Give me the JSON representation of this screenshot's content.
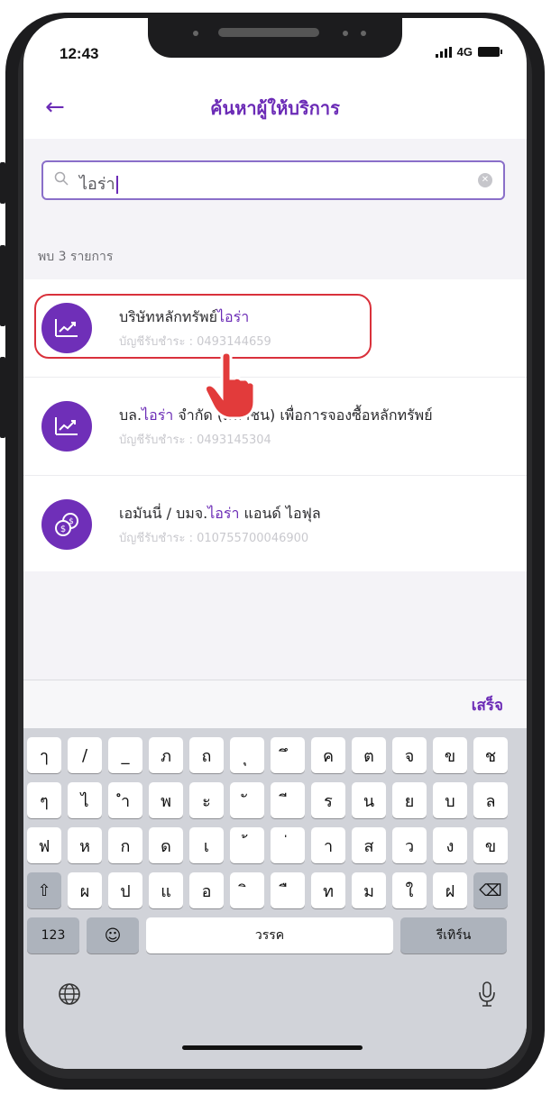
{
  "status_bar": {
    "time": "12:43",
    "network": "4G"
  },
  "header": {
    "back_icon": "arrow-left-icon",
    "title": "ค้นหาผู้ให้บริการ"
  },
  "search": {
    "value": "ไอร่า",
    "icon": "search-icon",
    "clear_icon": "clear-icon"
  },
  "results_count": "พบ 3 รายการ",
  "results": [
    {
      "name_prefix": "บริษัทหลักทรัพย์",
      "name_highlight": "ไอร่า",
      "name_suffix": "",
      "account": "บัญชีรับชำระ : 0493144659",
      "icon": "chart-up-icon"
    },
    {
      "name_prefix": "บล.",
      "name_highlight": "ไอร่า",
      "name_suffix": " จำกัด (มหาชน) เพื่อการจองซื้อหลักทรัพย์",
      "account": "บัญชีรับชำระ : 0493145304",
      "icon": "chart-up-icon"
    },
    {
      "name_prefix": "เอมันนี่ / บมจ.",
      "name_highlight": "ไอร่า",
      "name_suffix": " แอนด์ ไอฟุล",
      "account": "บัญชีรับชำระ : 010755700046900",
      "icon": "coins-icon"
    }
  ],
  "keyboard": {
    "done_label": "เสร็จ",
    "row1": [
      "ๅ",
      "/",
      "_",
      "ภ",
      "ถ",
      "ุ",
      "ึ",
      "ค",
      "ต",
      "จ",
      "ข",
      "ช"
    ],
    "row2": [
      "ๆ",
      "ไ",
      "ำ",
      "พ",
      "ะ",
      "ั",
      "ี",
      "ร",
      "น",
      "ย",
      "บ",
      "ล"
    ],
    "row3": [
      "ฟ",
      "ห",
      "ก",
      "ด",
      "เ",
      "้",
      "่",
      "า",
      "ส",
      "ว",
      "ง",
      "ข"
    ],
    "row4": [
      "ผ",
      "ป",
      "แ",
      "อ",
      "ิ",
      "ื",
      "ท",
      "ม",
      "ใ",
      "ฝ"
    ],
    "shift_icon": "shift-icon",
    "backspace_icon": "backspace-icon",
    "numbers_label": "123",
    "emoji_icon": "emoji-icon",
    "space_label": "วรรค",
    "return_label": "รีเทิร์น",
    "globe_icon": "globe-icon",
    "mic_icon": "microphone-icon"
  },
  "colors": {
    "accent": "#6b2bb6",
    "highlight_border": "#d9313b"
  }
}
